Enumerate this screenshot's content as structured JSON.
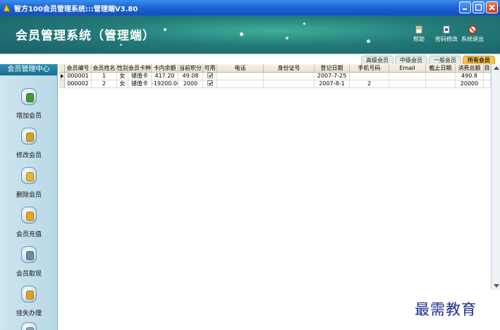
{
  "window": {
    "title": "智方100会员管理系统:::管理端V3.80",
    "controls": [
      "minimize-icon",
      "maximize-icon",
      "close-icon"
    ]
  },
  "header": {
    "title": "会员管理系统（管理端）",
    "buttons": [
      {
        "label": "帮助",
        "icon": "help-icon"
      },
      {
        "label": "密码修改",
        "icon": "password-icon"
      },
      {
        "label": "系统退出",
        "icon": "exit-icon"
      }
    ]
  },
  "filter_tabs": [
    {
      "label": "高级会员",
      "active": false
    },
    {
      "label": "中级会员",
      "active": false
    },
    {
      "label": "一般会员",
      "active": false
    },
    {
      "label": "所有会员",
      "active": true
    }
  ],
  "sidebar": {
    "title": "会员管理中心",
    "items": [
      {
        "label": "增加会员",
        "icon": "add-member-icon",
        "color": "#3c9a3c"
      },
      {
        "label": "修改会员",
        "icon": "edit-member-icon",
        "color": "#d8a020"
      },
      {
        "label": "删除会员",
        "icon": "delete-member-icon",
        "color": "#e0b830"
      },
      {
        "label": "会员充值",
        "icon": "recharge-icon",
        "color": "#e8a818"
      },
      {
        "label": "会员取现",
        "icon": "withdraw-icon",
        "color": "#6a8aa8"
      },
      {
        "label": "挂失办理",
        "icon": "report-loss-icon",
        "color": "#e0a020"
      }
    ]
  },
  "table": {
    "columns": [
      "会员编号",
      "会员姓名",
      "性别",
      "会员卡种",
      "卡内余额",
      "当前积分",
      "可用",
      "电话",
      "身份证号",
      "登记日期",
      "手机号码",
      "Email",
      "截止日期",
      "消费总额",
      "目"
    ],
    "rows": [
      [
        "000001",
        "1",
        "女",
        "储值卡",
        "417.20",
        "49.08",
        true,
        "",
        "",
        "2007-7-25",
        "",
        "",
        "",
        "490.8",
        ""
      ],
      [
        "000002",
        "2",
        "女",
        "储值卡",
        "-19200.00",
        "2000",
        true,
        "",
        "",
        "2007-8-1",
        "2",
        "",
        "",
        "20000",
        ""
      ]
    ]
  },
  "watermark": "最需教育"
}
